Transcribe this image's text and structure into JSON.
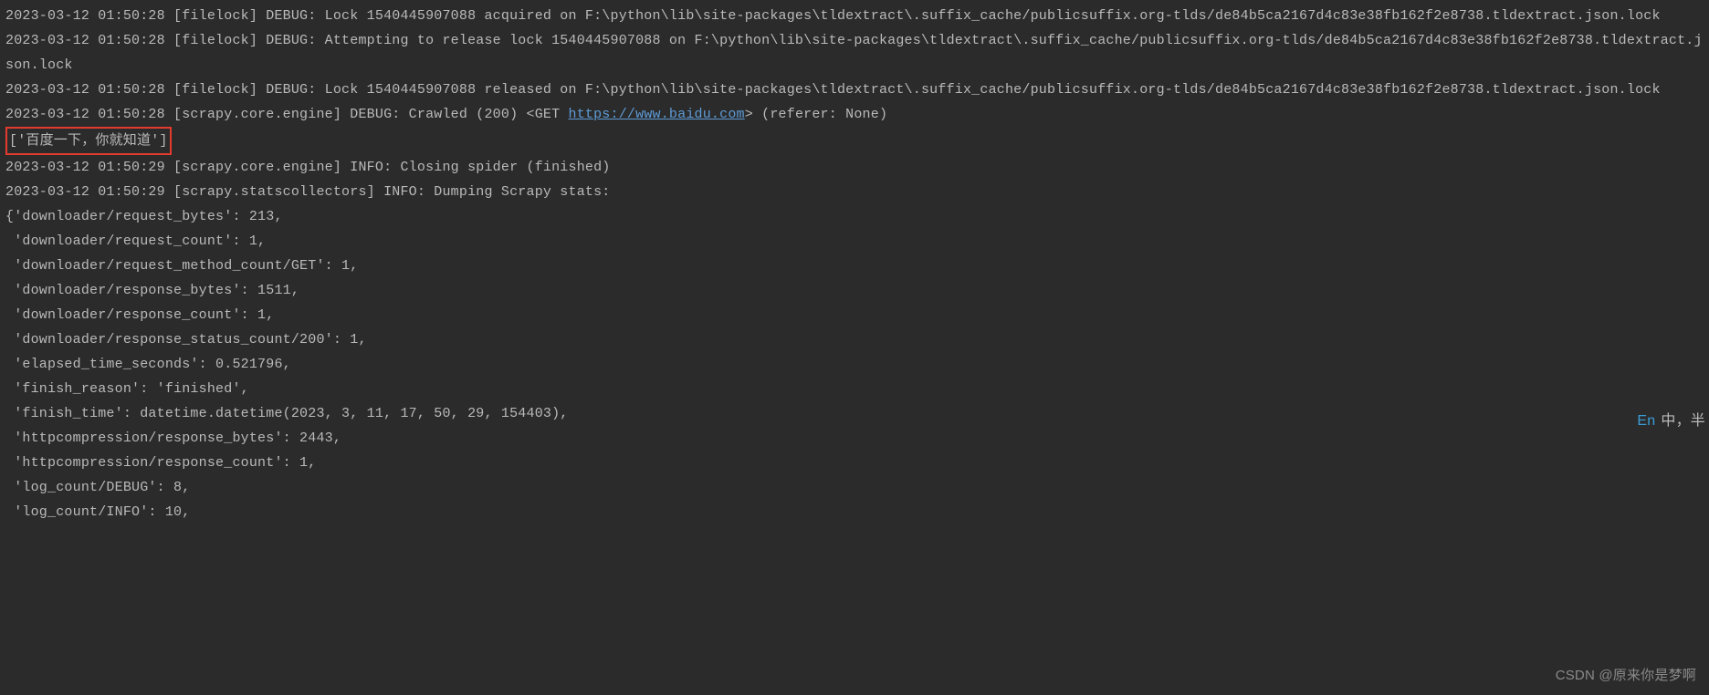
{
  "log": {
    "l1": "2023-03-12 01:50:28 [filelock] DEBUG: Lock 1540445907088 acquired on F:\\python\\lib\\site-packages\\tldextract\\.suffix_cache/publicsuffix.org-tlds/de84b5ca2167d4c83e38fb162f2e8738.tldextract.json.lock",
    "l2": "2023-03-12 01:50:28 [filelock] DEBUG: Attempting to release lock 1540445907088 on F:\\python\\lib\\site-packages\\tldextract\\.suffix_cache/publicsuffix.org-tlds/de84b5ca2167d4c83e38fb162f2e8738.tldextract.json.lock",
    "l3": "2023-03-12 01:50:28 [filelock] DEBUG: Lock 1540445907088 released on F:\\python\\lib\\site-packages\\tldextract\\.suffix_cache/publicsuffix.org-tlds/de84b5ca2167d4c83e38fb162f2e8738.tldextract.json.lock",
    "l4a": "2023-03-12 01:50:28 [scrapy.core.engine] DEBUG: Crawled (200) <GET ",
    "l4url": "https://www.baidu.com",
    "l4b": "> (referer: None)",
    "l5": "['百度一下，你就知道']",
    "l6": "2023-03-12 01:50:29 [scrapy.core.engine] INFO: Closing spider (finished)",
    "l7": "2023-03-12 01:50:29 [scrapy.statscollectors] INFO: Dumping Scrapy stats:",
    "l8": "{'downloader/request_bytes': 213,",
    "l9": " 'downloader/request_count': 1,",
    "l10": " 'downloader/request_method_count/GET': 1,",
    "l11": " 'downloader/response_bytes': 1511,",
    "l12": " 'downloader/response_count': 1,",
    "l13": " 'downloader/response_status_count/200': 1,",
    "l14": " 'elapsed_time_seconds': 0.521796,",
    "l15": " 'finish_reason': 'finished',",
    "l16": " 'finish_time': datetime.datetime(2023, 3, 11, 17, 50, 29, 154403),",
    "l17": " 'httpcompression/response_bytes': 2443,",
    "l18": " 'httpcompression/response_count': 1,",
    "l19": " 'log_count/DEBUG': 8,",
    "l20": " 'log_count/INFO': 10,"
  },
  "ime": {
    "lang": "En",
    "mode": "中，半"
  },
  "watermark": "CSDN @原来你是梦啊"
}
